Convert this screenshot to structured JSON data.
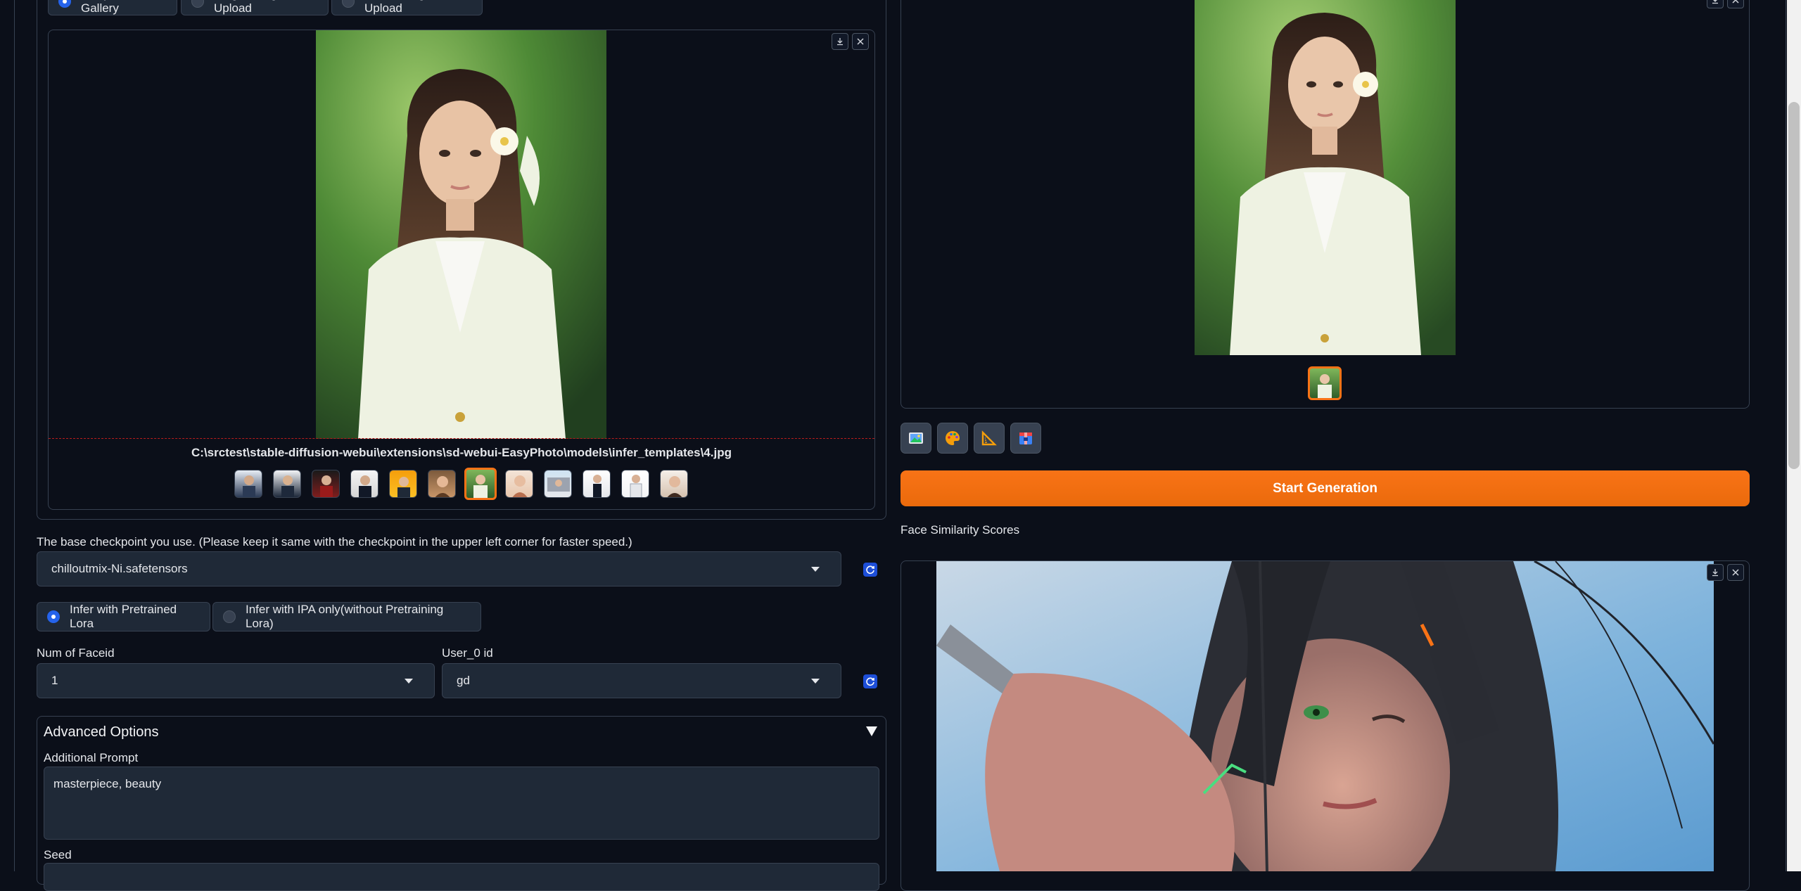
{
  "template_source": {
    "options": [
      "Template Gallery",
      "Single Image Upload",
      "Batch Images Upload"
    ],
    "selected": "Template Gallery"
  },
  "gallery": {
    "image_path": "C:\\srctest\\stable-diffusion-webui\\extensions\\sd-webui-EasyPhoto\\models\\infer_templates\\4.jpg",
    "thumbnail_count": 12,
    "selected_index": 6,
    "thumbnail_icon": "portrait-thumbnail"
  },
  "checkpoint": {
    "label": "The base checkpoint you use. (Please keep it same with the checkpoint in the upper left corner for faster speed.)",
    "value": "chilloutmix-Ni.safetensors"
  },
  "infer_mode": {
    "options": [
      "Infer with Pretrained Lora",
      "Infer with IPA only(without Pretraining Lora)"
    ],
    "selected": "Infer with Pretrained Lora"
  },
  "num_faceid": {
    "label": "Num of Faceid",
    "value": "1"
  },
  "user_id": {
    "label": "User_0 id",
    "value": "gd"
  },
  "advanced": {
    "title": "Advanced Options",
    "prompt_label": "Additional Prompt",
    "prompt_value": "masterpiece, beauty",
    "seed_label": "Seed"
  },
  "output": {
    "tool_icons": [
      "image-icon",
      "palette-icon",
      "ruler-icon",
      "zip-icon"
    ],
    "start_button": "Start Generation",
    "similarity_label": "Face Similarity Scores"
  },
  "colors": {
    "accent": "#f97316",
    "background": "#0b0f19",
    "input_bg": "#1f2937",
    "border": "#374151",
    "radio_on": "#2563eb"
  }
}
